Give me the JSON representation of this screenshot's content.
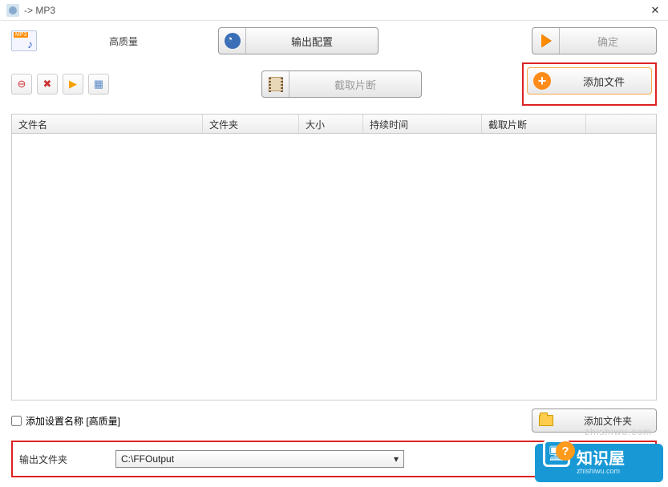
{
  "titlebar": {
    "title": " -> MP3"
  },
  "row1": {
    "quality_label": "高质量",
    "output_config_label": "输出配置",
    "ok_label": "确定"
  },
  "row2": {
    "trim_label": "截取片断",
    "add_file_label": "添加文件"
  },
  "table": {
    "headers": {
      "filename": "文件名",
      "folder": "文件夹",
      "size": "大小",
      "duration": "持续时间",
      "trim": "截取片断"
    }
  },
  "bottom": {
    "add_setting_name_label": "添加设置名称  [高质量]",
    "add_folder_label": "添加文件夹"
  },
  "output": {
    "label": "输出文件夹",
    "value": "C:\\FFOutput"
  },
  "watermark": {
    "faint": "zhishiwu.com",
    "text": "知识屋",
    "sub": "zhishiwu.com"
  }
}
